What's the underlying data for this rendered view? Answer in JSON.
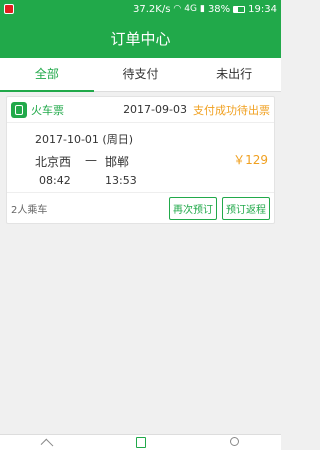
{
  "status_bar": {
    "speed": "37.2K/s",
    "network": "4G",
    "battery": "38%",
    "time": "19:34"
  },
  "title": "订单中心",
  "tabs": [
    {
      "label": "全部",
      "active": true
    },
    {
      "label": "待支付",
      "active": false
    },
    {
      "label": "未出行",
      "active": false
    }
  ],
  "order": {
    "type": "火车票",
    "order_date": "2017-09-03",
    "status": "支付成功待出票",
    "travel_date": "2017-10-01 (周日)",
    "from": "北京西",
    "dash": "—",
    "to": "邯郸",
    "depart_time": "08:42",
    "arrive_time": "13:53",
    "price": "￥129",
    "passengers": "2人乘车",
    "rebook_label": "再次预订",
    "return_label": "预订返程"
  },
  "colors": {
    "brand": "#21a94a",
    "price": "#f0a020"
  },
  "icons": {
    "nav": [
      "home-icon",
      "order-icon",
      "search-icon"
    ]
  }
}
